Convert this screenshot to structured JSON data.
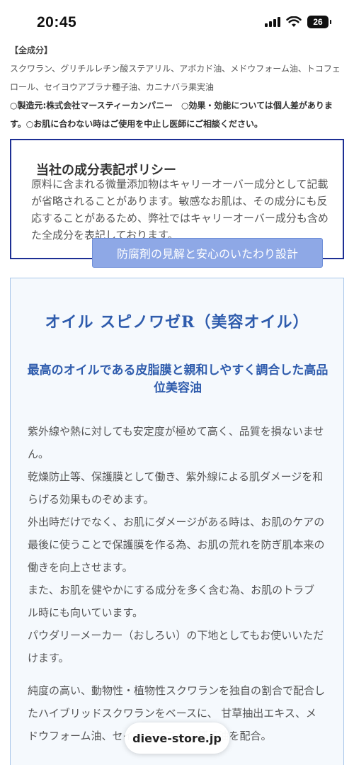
{
  "status_bar": {
    "time": "20:45",
    "battery": "26",
    "icons": [
      "signal-icon",
      "wifi-icon",
      "battery-icon"
    ]
  },
  "ingredients": {
    "heading": "【全成分】",
    "list": "スクワラン、グリチルレチン酸ステアリル、アボカド油、メドウフォーム油、トコフェロール、セイヨウアブラナ種子油、カニナバラ果実油",
    "note": "○製造元:株式会社マースティーカンパニー　○効果・効能については個人差があります。○お肌に合わない時はご使用を中止し医師にご相談ください。"
  },
  "policy": {
    "title": "当社の成分表記ポリシー",
    "text": "原料に含まれる微量添加物はキャリーオーバー成分として記載が省略されることがあります。敏感なお肌は、その成分にも反応することがあるため、弊社ではキャリーオーバー成分も含めた全成分を表記しております。",
    "tab_label": "防腐剤の見解と安心のいたわり設計"
  },
  "product": {
    "title": "オイル スピノワゼR（美容オイル）",
    "subtitle": "最高のオイルである皮脂膜と親和しやすく調合した高品位美容油",
    "paragraphs": [
      "紫外線や熱に対しても安定度が極めて高く、品質を損ないません。",
      "乾燥防止等、保護膜として働き、紫外線による肌ダメージを和らげる効果ものぞめます。",
      "外出時だけでなく、お肌にダメージがある時は、お肌のケアの最後に使うことで保護膜を作る為、お肌の荒れを防ぎ肌本来の働きを向上させます。",
      "また、お肌を健やかにする成分を多く含む為、お肌のトラブル時にも向いています。",
      "パウダリーメーカー（おしろい）の下地としてもお使いいただけます。"
    ],
    "paragraph2": "純度の高い、動物性・植物性スクワランを独自の割合で配合したハイブリッドスクワランをベースに、 甘草抽出エキス、メドウフォーム油、セイヨウアブラナ種子油を配合。"
  },
  "browser": {
    "url": "dieve-store.jp"
  }
}
